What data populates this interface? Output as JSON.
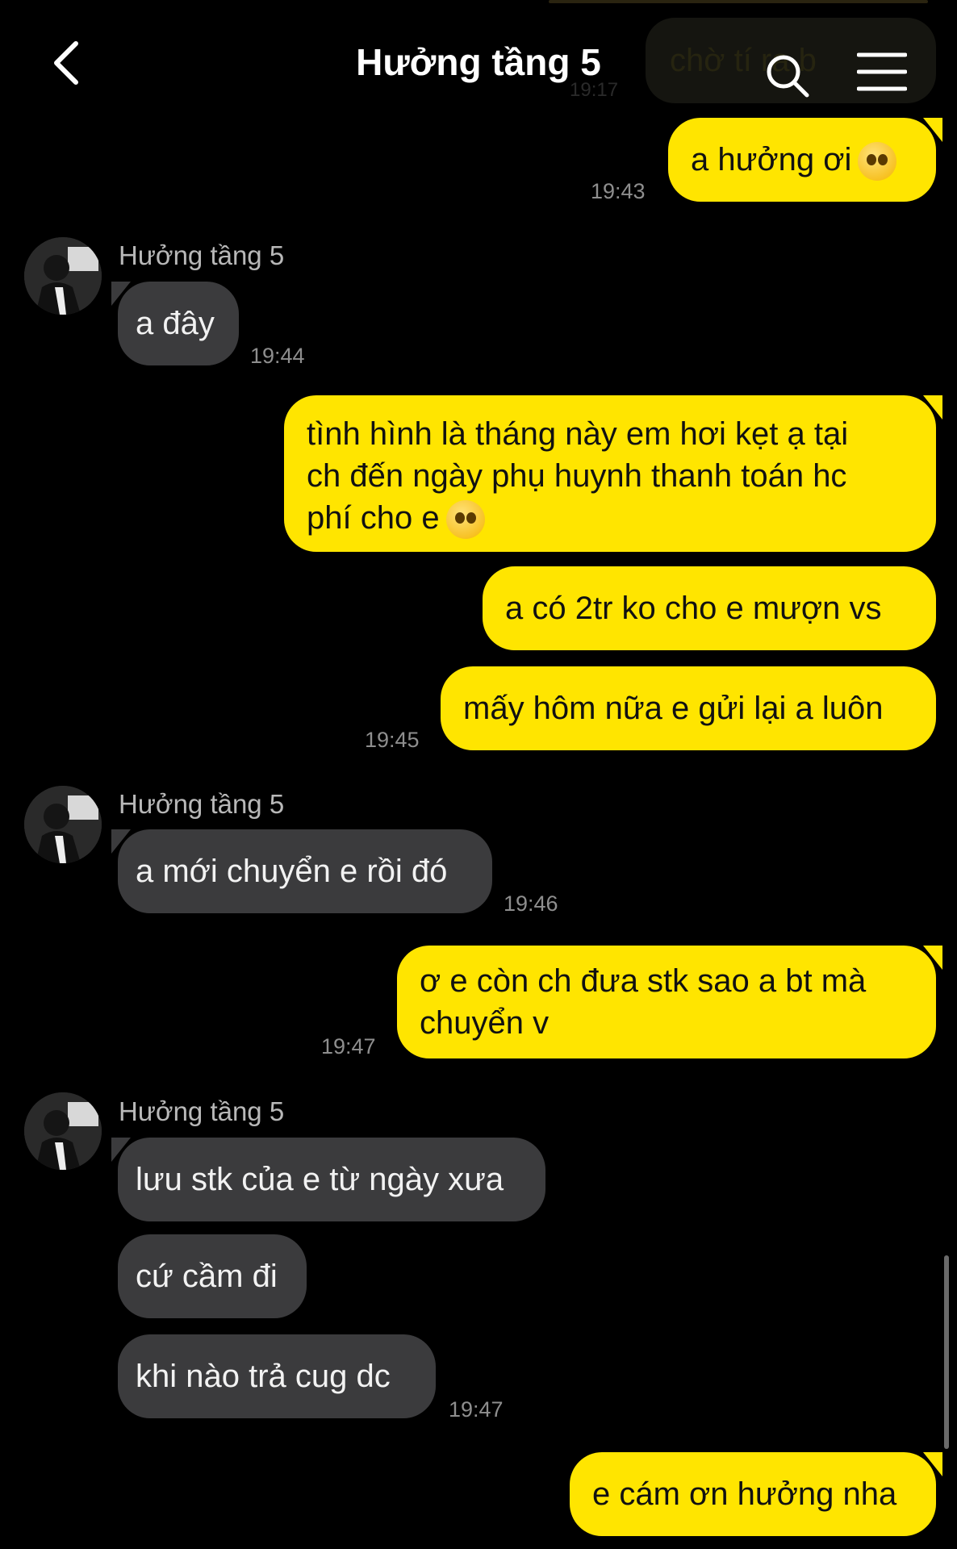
{
  "header": {
    "title": "Hưởng tầng 5",
    "back_icon": "chevron-left-icon",
    "search_icon": "search-icon",
    "menu_icon": "hamburger-menu-icon"
  },
  "partial_message": {
    "text": "chờ tí ra b",
    "time": "19:17"
  },
  "messages": [
    {
      "text": "a hưởng ơi",
      "time": "19:43"
    },
    {
      "sender": "Hưởng tầng 5",
      "text": "a đây",
      "time": "19:44"
    },
    {
      "line1": "tình hình là tháng này em hơi kẹt ạ tại",
      "line2": "ch đến ngày phụ huynh thanh toán hc",
      "line3": "phí cho e"
    },
    {
      "text": "a có 2tr ko cho e mượn vs"
    },
    {
      "text": "mấy hôm nữa e gửi lại a luôn",
      "time": "19:45"
    },
    {
      "sender": "Hưởng tầng 5",
      "text": "a mới chuyển e rồi đó",
      "time": "19:46"
    },
    {
      "line1": "ơ e còn ch đưa stk sao a bt mà",
      "line2": "chuyển v",
      "time": "19:47"
    },
    {
      "sender": "Hưởng tầng 5",
      "text": "lưu stk của e từ ngày xưa"
    },
    {
      "text": "cứ cầm đi"
    },
    {
      "text": "khi nào trả cug dc",
      "time": "19:47"
    },
    {
      "text": "e cám ơn hưởng nha"
    }
  ],
  "colors": {
    "outgoing": "#FFE500",
    "incoming": "#3b3b3d",
    "background": "#000000"
  }
}
